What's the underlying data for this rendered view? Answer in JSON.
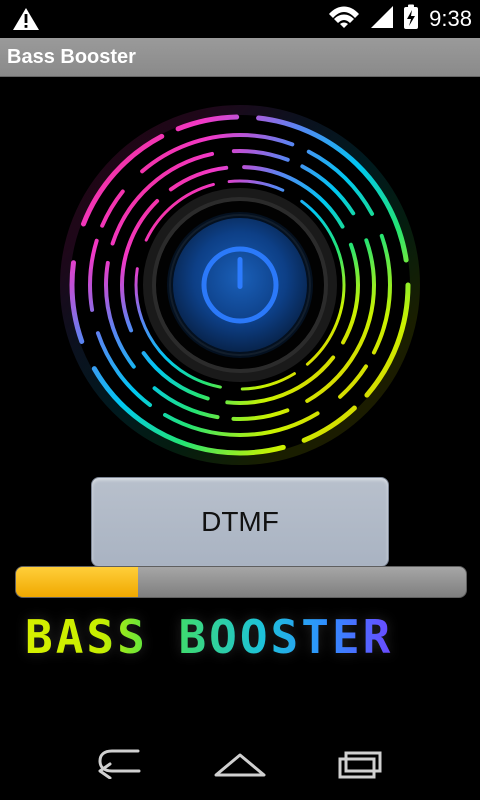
{
  "status_bar": {
    "left_icon": "warning-icon",
    "right_icons": [
      "wifi-icon",
      "signal-icon",
      "battery-charging-icon"
    ],
    "time": "9:38"
  },
  "app_bar": {
    "title": "Bass Booster"
  },
  "main": {
    "power_button_icon": "power-icon",
    "dtmf_button_label": "DTMF",
    "boost_level_percent": 27,
    "logo_text": "BASS BOOSTER"
  },
  "nav_bar": {
    "back_icon": "back-icon",
    "home_icon": "home-icon",
    "recents_icon": "recents-icon"
  },
  "colors": {
    "title_bar": "#8f8f8f",
    "dtmf_button": "#b0b8c6",
    "seek_fill": "#ffc000",
    "seek_track": "#8f8f8f",
    "power_blue": "#1f6ee8",
    "background": "#000000"
  }
}
